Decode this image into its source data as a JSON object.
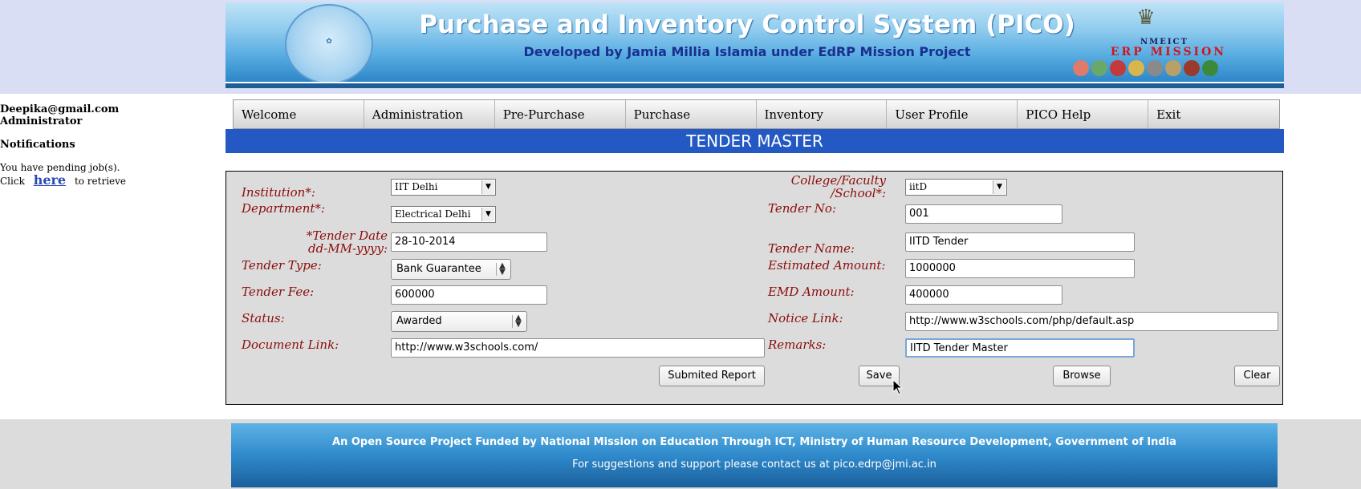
{
  "header": {
    "title": "Purchase and Inventory Control System (PICO)",
    "subtitle": "Developed by Jamia Millia Islamia under EdRP Mission Project",
    "erp_top": "NMEICT",
    "erp_title": "ERP MISSION",
    "logo_icon": "jmi-seal-icon",
    "emblem_icon": "national-emblem-icon"
  },
  "user": {
    "email": "Deepika@gmail.com",
    "role": "Administrator",
    "notifications_label": "Notifications",
    "pending_text": "You have pending job(s).",
    "click_text": "Click",
    "here_link": "here",
    "retrieve_text": "to retrieve"
  },
  "menu": {
    "items": [
      "Welcome",
      "Administration",
      "Pre-Purchase",
      "Purchase",
      "Inventory",
      "User Profile",
      "PICO Help",
      "Exit"
    ]
  },
  "page_title": "TENDER MASTER",
  "form": {
    "institution_label": "Institution*:",
    "institution_value": "IIT Delhi",
    "college_label_1": "College/Faculty",
    "college_label_2": "/School*:",
    "college_value": "iitD",
    "department_label": "Department*:",
    "department_value": "Electrical Delhi",
    "tender_no_label": "Tender No:",
    "tender_no_value": "001",
    "tender_date_label_1": "*Tender Date",
    "tender_date_label_2": "dd-MM-yyyy:",
    "tender_date_value": "28-10-2014",
    "tender_name_label": "Tender Name:",
    "tender_name_value": "IITD Tender",
    "tender_type_label": "Tender Type:",
    "tender_type_value": "Bank Guarantee",
    "estimated_amount_label": "Estimated Amount:",
    "estimated_amount_value": "1000000",
    "tender_fee_label": "Tender Fee:",
    "tender_fee_value": "600000",
    "emd_amount_label": "EMD Amount:",
    "emd_amount_value": "400000",
    "status_label": "Status:",
    "status_value": "Awarded",
    "notice_link_label": "Notice Link:",
    "notice_link_value": "http://www.w3schools.com/php/default.asp",
    "document_link_label": "Document Link:",
    "document_link_value": "http://www.w3schools.com/",
    "remarks_label": "Remarks:",
    "remarks_value": "IITD Tender Master"
  },
  "buttons": {
    "submitted_report": "Submited Report",
    "save": "Save",
    "browse": "Browse",
    "clear": "Clear"
  },
  "footer": {
    "line1": "An Open Source Project Funded by National Mission on Education Through ICT, Ministry of Human Resource Development, Government of India",
    "line2": "For suggestions and support please contact us at pico.edrp@jmi.ac.in"
  },
  "colors": {
    "title_bar": "#2459c4",
    "label_text": "#8b0c0c",
    "link": "#2a48b8"
  }
}
